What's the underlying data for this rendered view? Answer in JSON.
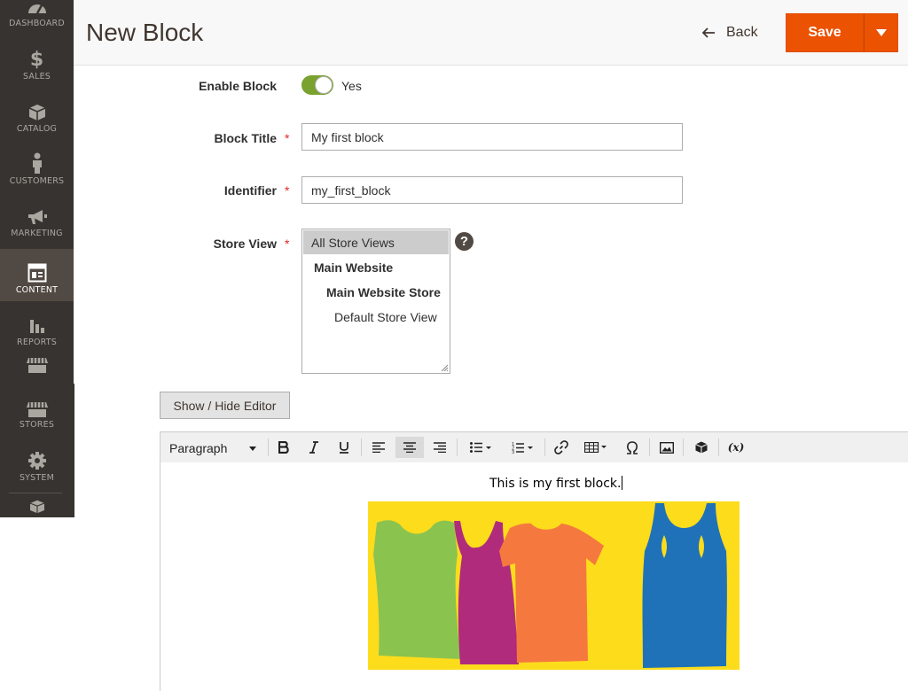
{
  "sidebar": {
    "items": [
      {
        "label": "Dashboard",
        "icon": "dashboard-icon"
      },
      {
        "label": "Sales",
        "icon": "dollar-icon"
      },
      {
        "label": "Catalog",
        "icon": "box-icon"
      },
      {
        "label": "Customers",
        "icon": "person-icon"
      },
      {
        "label": "Marketing",
        "icon": "megaphone-icon"
      },
      {
        "label": "Content",
        "icon": "layout-icon",
        "active": true
      },
      {
        "label": "Reports",
        "icon": "bar-chart-icon"
      },
      {
        "label": "",
        "icon": "storefront-icon"
      },
      {
        "label": "Stores",
        "icon": "storefront-icon"
      },
      {
        "label": "System",
        "icon": "gear-icon"
      },
      {
        "label": "",
        "icon": "cube-icon"
      }
    ]
  },
  "header": {
    "title": "New Block",
    "back_label": "Back",
    "save_label": "Save"
  },
  "form": {
    "enable": {
      "label": "Enable Block",
      "value": "Yes",
      "on": true
    },
    "title": {
      "label": "Block Title",
      "value": "My first block"
    },
    "identifier": {
      "label": "Identifier",
      "value": "my_first_block"
    },
    "store_view": {
      "label": "Store View",
      "options": [
        "All Store Views",
        "Main Website",
        "Main Website Store",
        "Default Store View"
      ],
      "selected": "All Store Views",
      "help": "?"
    },
    "required_mark": "*"
  },
  "editor": {
    "toggle_label": "Show / Hide Editor",
    "format": "Paragraph",
    "content_text": "This is my first block.",
    "variable_label": "(x)",
    "image": "t-shirts-on-yellow-image"
  },
  "colors": {
    "sidebar_bg": "#373330",
    "sidebar_active": "#514943",
    "accent": "#eb5202",
    "toggle_on": "#79a22e",
    "image_bg": "#fddc1c"
  }
}
